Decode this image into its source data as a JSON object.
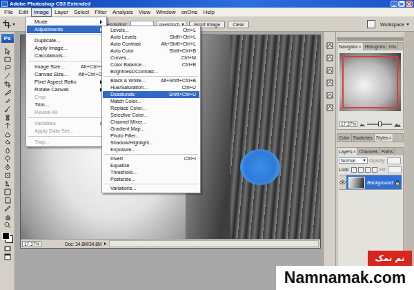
{
  "window": {
    "title": "Adobe Photoshop CS3 Extended"
  },
  "menubar": [
    {
      "label": "File",
      "selected": false
    },
    {
      "label": "Edit",
      "selected": false
    },
    {
      "label": "Image",
      "selected": true
    },
    {
      "label": "Layer",
      "selected": false
    },
    {
      "label": "Select",
      "selected": false
    },
    {
      "label": "Filter",
      "selected": false
    },
    {
      "label": "Analysis",
      "selected": false
    },
    {
      "label": "View",
      "selected": false
    },
    {
      "label": "Window",
      "selected": false
    },
    {
      "label": "onOne",
      "selected": false
    },
    {
      "label": "Help",
      "selected": false
    }
  ],
  "toolbox": {
    "logo": "Ps"
  },
  "options_bar": {
    "resolution_label": "Resolution:",
    "units": "pixels/inch",
    "buttons": [
      "Front Image",
      "Clear"
    ],
    "workspace": "Workspace"
  },
  "image_menu": [
    {
      "kind": "item",
      "label": "Mode",
      "submenu": true,
      "disabled": false,
      "selected": false
    },
    {
      "kind": "item",
      "label": "Adjustments",
      "submenu": true,
      "disabled": false,
      "selected": true
    },
    {
      "kind": "separator"
    },
    {
      "kind": "item",
      "label": "Duplicate...",
      "submenu": false,
      "disabled": false,
      "selected": false
    },
    {
      "kind": "item",
      "label": "Apply Image...",
      "submenu": false,
      "disabled": false,
      "selected": false
    },
    {
      "kind": "item",
      "label": "Calculations...",
      "submenu": false,
      "disabled": false,
      "selected": false
    },
    {
      "kind": "separator"
    },
    {
      "kind": "item",
      "label": "Image Size...",
      "shortcut": "Alt+Ctrl+I",
      "submenu": false,
      "disabled": false,
      "selected": false
    },
    {
      "kind": "item",
      "label": "Canvas Size...",
      "shortcut": "Alt+Ctrl+C",
      "submenu": false,
      "disabled": false,
      "selected": false
    },
    {
      "kind": "item",
      "label": "Pixel Aspect Ratio",
      "submenu": true,
      "disabled": false,
      "selected": false
    },
    {
      "kind": "item",
      "label": "Rotate Canvas",
      "submenu": true,
      "disabled": false,
      "selected": false
    },
    {
      "kind": "item",
      "label": "Crop",
      "submenu": false,
      "disabled": true,
      "selected": false
    },
    {
      "kind": "item",
      "label": "Trim...",
      "submenu": false,
      "disabled": false,
      "selected": false
    },
    {
      "kind": "item",
      "label": "Reveal All",
      "submenu": false,
      "disabled": true,
      "selected": false
    },
    {
      "kind": "separator"
    },
    {
      "kind": "item",
      "label": "Variables",
      "submenu": true,
      "disabled": true,
      "selected": false
    },
    {
      "kind": "item",
      "label": "Apply Data Set...",
      "submenu": false,
      "disabled": true,
      "selected": false
    },
    {
      "kind": "separator"
    },
    {
      "kind": "item",
      "label": "Trap...",
      "submenu": false,
      "disabled": true,
      "selected": false
    }
  ],
  "adjustments_menu": [
    {
      "kind": "item",
      "label": "Levels...",
      "shortcut": "Ctrl+L",
      "submenu": false,
      "disabled": false,
      "selected": false
    },
    {
      "kind": "item",
      "label": "Auto Levels",
      "shortcut": "Shift+Ctrl+L",
      "submenu": false,
      "disabled": false,
      "selected": false
    },
    {
      "kind": "item",
      "label": "Auto Contrast",
      "shortcut": "Alt+Shift+Ctrl+L",
      "submenu": false,
      "disabled": false,
      "selected": false
    },
    {
      "kind": "item",
      "label": "Auto Color",
      "shortcut": "Shift+Ctrl+B",
      "submenu": false,
      "disabled": false,
      "selected": false
    },
    {
      "kind": "item",
      "label": "Curves...",
      "shortcut": "Ctrl+M",
      "submenu": false,
      "disabled": false,
      "selected": false
    },
    {
      "kind": "item",
      "label": "Color Balance...",
      "shortcut": "Ctrl+B",
      "submenu": false,
      "disabled": false,
      "selected": false
    },
    {
      "kind": "item",
      "label": "Brightness/Contrast...",
      "submenu": false,
      "disabled": false,
      "selected": false
    },
    {
      "kind": "separator"
    },
    {
      "kind": "item",
      "label": "Black & White...",
      "shortcut": "Alt+Shift+Ctrl+B",
      "submenu": false,
      "disabled": false,
      "selected": false
    },
    {
      "kind": "item",
      "label": "Hue/Saturation...",
      "shortcut": "Ctrl+U",
      "submenu": false,
      "disabled": false,
      "selected": false
    },
    {
      "kind": "item",
      "label": "Desaturate",
      "shortcut": "Shift+Ctrl+U",
      "submenu": false,
      "disabled": false,
      "selected": true
    },
    {
      "kind": "item",
      "label": "Match Color...",
      "submenu": false,
      "disabled": false,
      "selected": false
    },
    {
      "kind": "item",
      "label": "Replace Color...",
      "submenu": false,
      "disabled": false,
      "selected": false
    },
    {
      "kind": "item",
      "label": "Selective Color...",
      "submenu": false,
      "disabled": false,
      "selected": false
    },
    {
      "kind": "item",
      "label": "Channel Mixer...",
      "submenu": false,
      "disabled": false,
      "selected": false
    },
    {
      "kind": "item",
      "label": "Gradient Map...",
      "submenu": false,
      "disabled": false,
      "selected": false
    },
    {
      "kind": "item",
      "label": "Photo Filter...",
      "submenu": false,
      "disabled": false,
      "selected": false
    },
    {
      "kind": "item",
      "label": "Shadow/Highlight...",
      "submenu": false,
      "disabled": false,
      "selected": false
    },
    {
      "kind": "item",
      "label": "Exposure...",
      "submenu": false,
      "disabled": false,
      "selected": false
    },
    {
      "kind": "separator"
    },
    {
      "kind": "item",
      "label": "Invert",
      "shortcut": "Ctrl+I",
      "submenu": false,
      "disabled": false,
      "selected": false
    },
    {
      "kind": "item",
      "label": "Equalize",
      "submenu": false,
      "disabled": false,
      "selected": false
    },
    {
      "kind": "item",
      "label": "Threshold...",
      "submenu": false,
      "disabled": false,
      "selected": false
    },
    {
      "kind": "item",
      "label": "Posterize...",
      "submenu": false,
      "disabled": false,
      "selected": false
    },
    {
      "kind": "separator"
    },
    {
      "kind": "item",
      "label": "Variations...",
      "submenu": false,
      "disabled": false,
      "selected": false
    }
  ],
  "document": {
    "zoom": "17.37%",
    "doc_info": "Doc: 34.8M/34.8M"
  },
  "navigator_panel": {
    "tabs": [
      {
        "label": "Navigator",
        "selected": true
      },
      {
        "label": "Histogram",
        "selected": false
      },
      {
        "label": "Info",
        "selected": false
      }
    ],
    "close_glyph": "×",
    "zoom": "17.37%",
    "zoom_level": 0.5
  },
  "color_panel": {
    "tabs": [
      {
        "label": "Color",
        "selected": false
      },
      {
        "label": "Swatches",
        "selected": false
      },
      {
        "label": "Styles",
        "selected": true
      }
    ],
    "close_glyph": "×"
  },
  "layers_panel": {
    "tabs": [
      {
        "label": "Layers",
        "selected": true
      },
      {
        "label": "Channels",
        "selected": false
      },
      {
        "label": "Paths",
        "selected": false
      }
    ],
    "close_glyph": "×",
    "blend_mode": "Normal",
    "opacity_label": "Opacity:",
    "lock_label": "Lock:",
    "fill_label": "Fill:",
    "layers": [
      {
        "name": "Background",
        "selected": true,
        "visible": true,
        "locked": true
      }
    ]
  },
  "watermark": {
    "badge": "نم نمک",
    "site": "Namnamak.com"
  }
}
